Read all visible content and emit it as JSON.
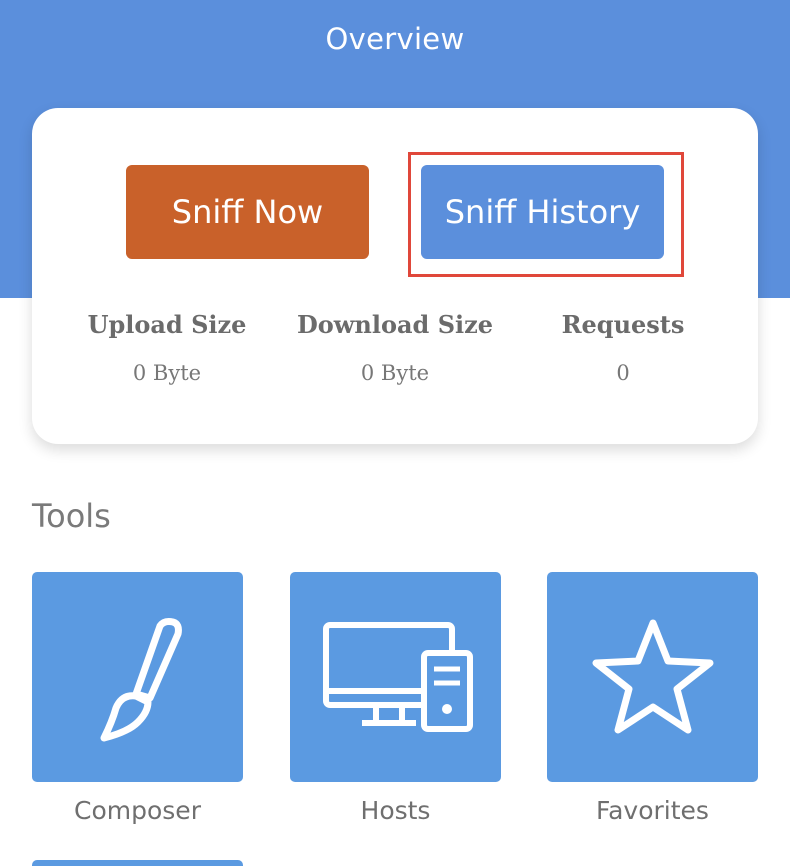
{
  "header": {
    "title": "Overview"
  },
  "overview": {
    "sniff_now_label": "Sniff Now",
    "sniff_history_label": "Sniff History",
    "stats": {
      "upload": {
        "label": "Upload Size",
        "value": "0 Byte"
      },
      "download": {
        "label": "Download Size",
        "value": "0 Byte"
      },
      "requests": {
        "label": "Requests",
        "value": "0"
      }
    }
  },
  "tools": {
    "heading": "Tools",
    "items": [
      {
        "label": "Composer",
        "icon": "brush-icon"
      },
      {
        "label": "Hosts",
        "icon": "computer-icon"
      },
      {
        "label": "Favorites",
        "icon": "star-icon"
      }
    ]
  },
  "colors": {
    "header_bg": "#5b8fdc",
    "sniff_now_bg": "#c9612a",
    "sniff_history_bg": "#5b8fdc",
    "tile_bg": "#5b9ae1",
    "highlight": "#e0473a"
  }
}
